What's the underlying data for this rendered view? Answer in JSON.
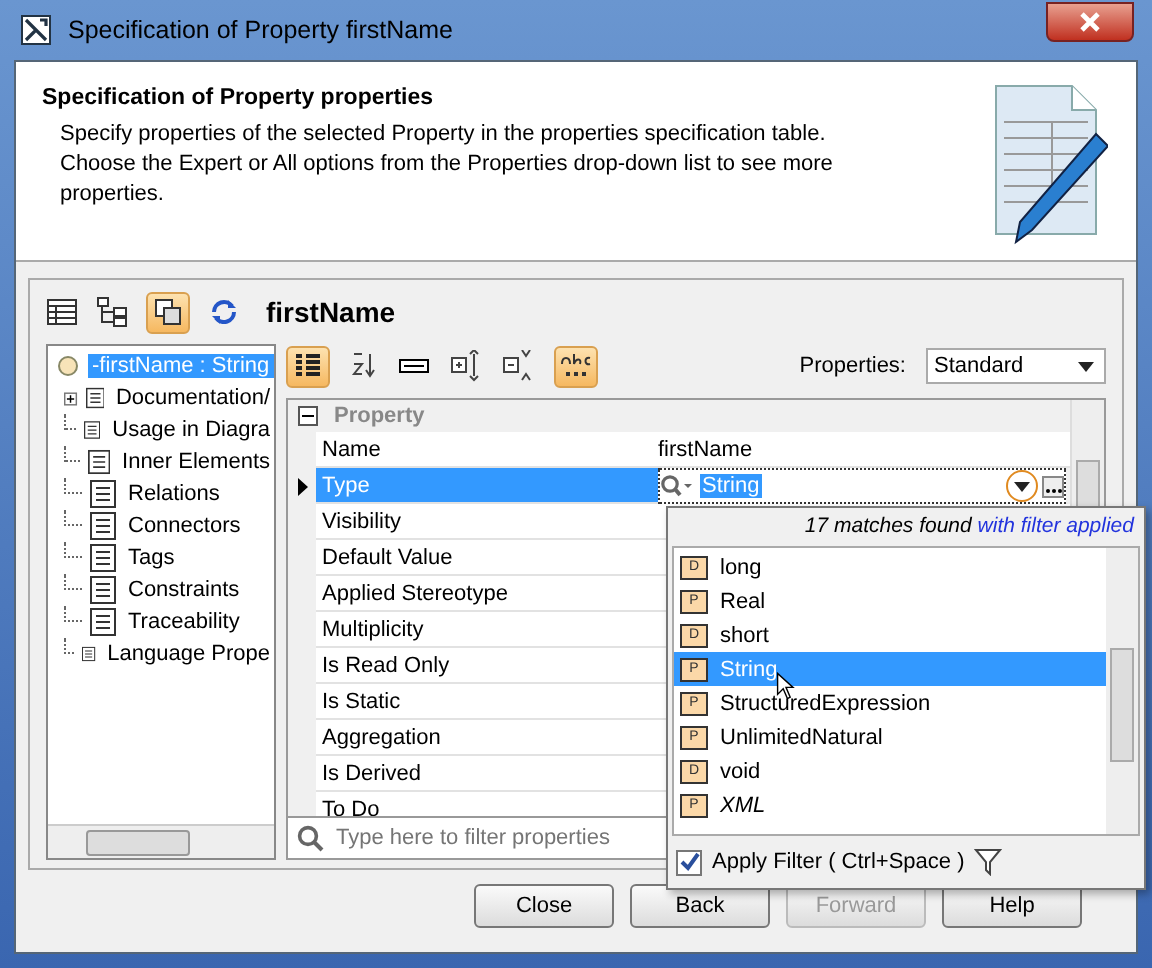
{
  "window": {
    "title": "Specification of Property firstName"
  },
  "header": {
    "title": "Specification of Property properties",
    "description": "Specify properties of the selected Property in the properties specification table. Choose the Expert or All options from the Properties drop-down list to see more properties."
  },
  "element_title": "firstName",
  "tree": {
    "root": {
      "label": "-firstName : String",
      "selected": true
    },
    "items": [
      {
        "label": "Documentation/",
        "expandable": true
      },
      {
        "label": "Usage in Diagra",
        "expandable": false
      },
      {
        "label": "Inner Elements",
        "expandable": false
      },
      {
        "label": "Relations",
        "expandable": false
      },
      {
        "label": "Connectors",
        "expandable": false
      },
      {
        "label": "Tags",
        "expandable": false
      },
      {
        "label": "Constraints",
        "expandable": false
      },
      {
        "label": "Traceability",
        "expandable": false
      },
      {
        "label": "Language Prope",
        "expandable": false
      }
    ]
  },
  "properties_filter": {
    "label": "Properties:",
    "value": "Standard"
  },
  "group": {
    "label": "Property",
    "expanded": true
  },
  "rows": [
    {
      "name": "Name",
      "value": "firstName",
      "selected": false
    },
    {
      "name": "Type",
      "value": "String",
      "selected": true
    },
    {
      "name": "Visibility",
      "selected": false
    },
    {
      "name": "Default Value",
      "selected": false
    },
    {
      "name": "Applied Stereotype",
      "selected": false
    },
    {
      "name": "Multiplicity",
      "selected": false
    },
    {
      "name": "Is Read Only",
      "selected": false
    },
    {
      "name": "Is Static",
      "selected": false
    },
    {
      "name": "Aggregation",
      "selected": false
    },
    {
      "name": "Is Derived",
      "selected": false
    },
    {
      "name": "To Do",
      "selected": false
    }
  ],
  "filter_field": {
    "placeholder": "Type here to filter properties"
  },
  "popup": {
    "status": "17 matches found",
    "status_link": "with filter applied",
    "items": [
      {
        "badge": "D",
        "label": "long",
        "selected": false,
        "italic": false
      },
      {
        "badge": "P",
        "label": "Real",
        "selected": false,
        "italic": false
      },
      {
        "badge": "D",
        "label": "short",
        "selected": false,
        "italic": false
      },
      {
        "badge": "P",
        "label": "String",
        "selected": true,
        "italic": false
      },
      {
        "badge": "P",
        "label": "StructuredExpression",
        "selected": false,
        "italic": false
      },
      {
        "badge": "P",
        "label": "UnlimitedNatural",
        "selected": false,
        "italic": false
      },
      {
        "badge": "D",
        "label": "void",
        "selected": false,
        "italic": false
      },
      {
        "badge": "P",
        "label": "XML",
        "selected": false,
        "italic": true
      }
    ],
    "apply_filter": {
      "label": "Apply Filter ( Ctrl+Space )",
      "checked": true
    }
  },
  "buttons": [
    {
      "label": "Close",
      "disabled": false
    },
    {
      "label": "Back",
      "disabled": false
    },
    {
      "label": "Forward",
      "disabled": true
    },
    {
      "label": "Help",
      "disabled": false
    }
  ]
}
